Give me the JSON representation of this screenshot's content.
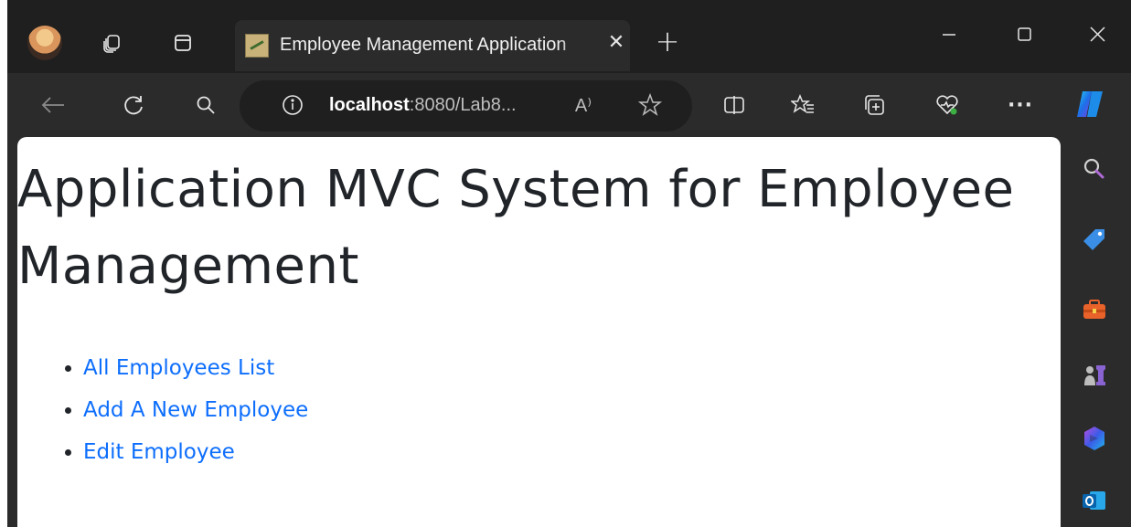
{
  "browser": {
    "tab_title": "Employee Management Application",
    "tab_close": "✕",
    "new_tab": "+",
    "url_host": "localhost",
    "url_rest": ":8080/Lab8...",
    "read_aloud": "A⁾",
    "window_controls": {
      "minimize": "—",
      "maximize": "☐",
      "close": "✕"
    },
    "more": "···"
  },
  "icons": {
    "tabbar": [
      "profile-avatar",
      "workspaces-icon",
      "tab-actions-icon",
      "tab-favicon"
    ],
    "toolbar": [
      "back-icon",
      "refresh-icon",
      "search-icon",
      "info-icon",
      "read-aloud-icon",
      "favorite-star-icon",
      "split-screen-icon",
      "favorites-icon",
      "collections-icon",
      "browser-essentials-icon",
      "more-icon",
      "copilot-icon"
    ],
    "sidebar": [
      "sidebar-search-icon",
      "shopping-tag-icon",
      "tools-icon",
      "games-icon",
      "microsoft-365-icon",
      "outlook-icon"
    ]
  },
  "page": {
    "heading": "Application MVC System for Employee Management",
    "links": [
      "All Employees List",
      "Add A New Employee",
      "Edit Employee"
    ]
  },
  "colors": {
    "link": "#0d6efd",
    "heading": "#212529",
    "chrome_dark": "#1f1f1f",
    "chrome": "#2b2b2b",
    "accent_red": "#c42b1c"
  }
}
